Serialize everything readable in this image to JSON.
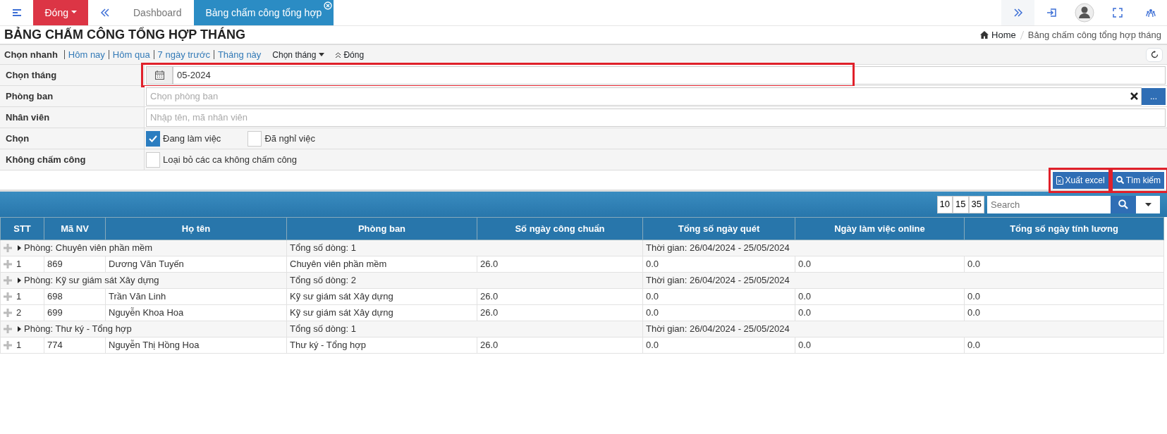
{
  "topbar": {
    "menu_label": "Đóng",
    "tabs": [
      {
        "label": "Dashboard",
        "selected": false
      },
      {
        "label": "Bảng chấm công tổng hợp",
        "selected": true
      }
    ]
  },
  "page_title": "BẢNG CHẤM CÔNG TỔNG HỢP THÁNG",
  "breadcrumb": [
    "Home",
    "Bảng chấm công tổng hợp tháng"
  ],
  "quick_filter": {
    "label": "Chọn nhanh",
    "links": [
      "Hôm nay",
      "Hôm qua",
      "7 ngày trước",
      "Tháng này"
    ],
    "month_menu": "Chọn tháng",
    "collapse": "Đóng"
  },
  "filters": [
    {
      "kind": "date",
      "label": "Chọn tháng",
      "value": "05-2024",
      "highlighted": true
    },
    {
      "kind": "select",
      "label": "Phòng ban",
      "placeholder": "Chọn phòng ban",
      "button": "..."
    },
    {
      "kind": "text",
      "label": "Nhân viên",
      "placeholder": "Nhập tên, mã nhân viên"
    },
    {
      "kind": "checks",
      "label": "Chọn",
      "options": [
        {
          "label": "Đang làm việc",
          "checked": true
        },
        {
          "label": "Đã nghỉ việc",
          "checked": false
        }
      ]
    },
    {
      "kind": "checks",
      "label": "Không chấm công",
      "options": [
        {
          "label": "Loại bỏ các ca không chấm công",
          "checked": false
        }
      ]
    }
  ],
  "actions": [
    {
      "kind": "excel",
      "label": "Xuất excel",
      "highlighted": true
    },
    {
      "kind": "search",
      "label": "Tìm kiếm",
      "highlighted": true
    }
  ],
  "page_sizes": [
    "10",
    "15",
    "35"
  ],
  "search": {
    "placeholder": "Search"
  },
  "table": {
    "columns": [
      "STT",
      "Mã NV",
      "Họ tên",
      "Phòng ban",
      "Số ngày công chuẩn",
      "Tổng số ngày quét",
      "Ngày làm việc online",
      "Tổng số ngày tính lương"
    ],
    "groups": [
      {
        "title": "Phòng: Chuyên viên phần mềm",
        "count": "Tổng số dòng: 1",
        "period": "Thời gian: 26/04/2024 - 25/05/2024",
        "rows": [
          [
            "1",
            "869",
            "Dương Văn Tuyến",
            "Chuyên viên phần mềm",
            "26.0",
            "0.0",
            "0.0",
            "0.0"
          ]
        ]
      },
      {
        "title": "Phòng: Kỹ sư giám sát Xây dựng",
        "count": "Tổng số dòng: 2",
        "period": "Thời gian: 26/04/2024 - 25/05/2024",
        "rows": [
          [
            "1",
            "698",
            "Trần Văn Linh",
            "Kỹ sư giám sát Xây dựng",
            "26.0",
            "0.0",
            "0.0",
            "0.0"
          ],
          [
            "2",
            "699",
            "Nguyễn Khoa Hoa",
            "Kỹ sư giám sát Xây dựng",
            "26.0",
            "0.0",
            "0.0",
            "0.0"
          ]
        ]
      },
      {
        "title": "Phòng: Thư ký - Tổng hợp",
        "count": "Tổng số dòng: 1",
        "period": "Thời gian: 26/04/2024 - 25/05/2024",
        "rows": [
          [
            "1",
            "774",
            "Nguyễn Thị Hồng Hoa",
            "Thư ký - Tổng hợp",
            "26.0",
            "0.0",
            "0.0",
            "0.0"
          ]
        ]
      }
    ]
  }
}
